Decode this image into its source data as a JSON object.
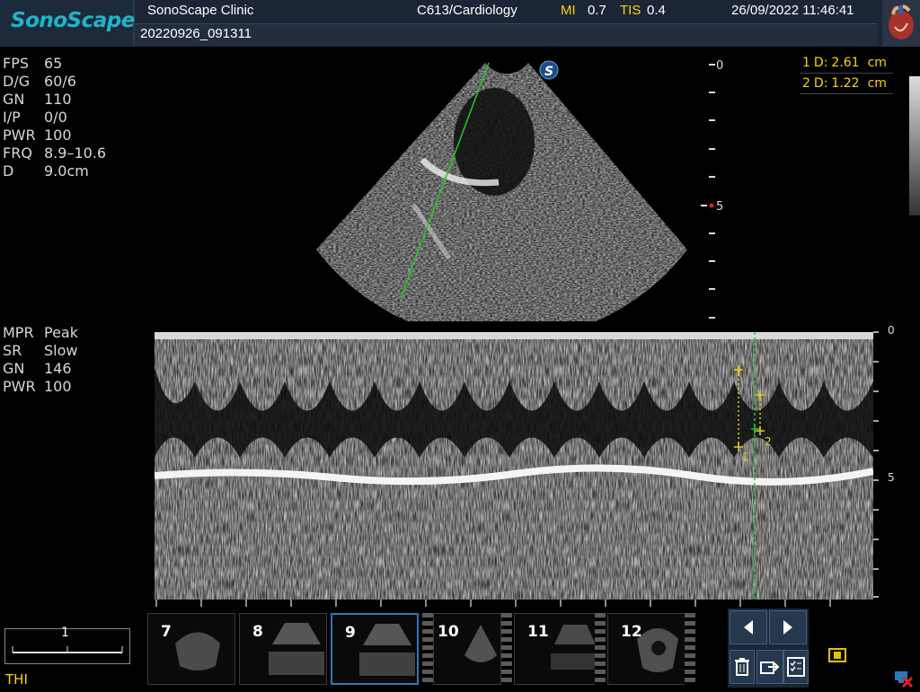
{
  "header": {
    "logo": "SonoScape",
    "clinic": "SonoScape Clinic",
    "probe_preset": "C613/Cardiology",
    "mi_label": "MI",
    "mi_value": "0.7",
    "tis_label": "TIS",
    "tis_value": "0.4",
    "datetime": "26/09/2022 11:46:41",
    "patient_id": "20220926_091311"
  },
  "bmode_params": [
    {
      "key": "FPS",
      "value": "65"
    },
    {
      "key": "D/G",
      "value": "60/6"
    },
    {
      "key": "GN",
      "value": "110"
    },
    {
      "key": "I/P",
      "value": "0/0"
    },
    {
      "key": "PWR",
      "value": "100"
    },
    {
      "key": "FRQ",
      "value": "8.9–10.6"
    },
    {
      "key": "D",
      "value": "9.0cm"
    }
  ],
  "mmode_params": [
    {
      "key": "MPR",
      "value": "Peak"
    },
    {
      "key": "SR",
      "value": "Slow"
    },
    {
      "key": "GN",
      "value": "146"
    },
    {
      "key": "PWR",
      "value": "100"
    }
  ],
  "measurements": [
    {
      "index": "1",
      "label": "D:",
      "value": "2.61",
      "unit": "cm"
    },
    {
      "index": "2",
      "label": "D:",
      "value": "1.22",
      "unit": "cm"
    }
  ],
  "depth_scale": {
    "top": "0",
    "mid": "5"
  },
  "mmode_scale": {
    "top": "0",
    "mid": "5"
  },
  "caliper_labels": {
    "one": "1",
    "two": "2"
  },
  "scale_bar_label": "1",
  "thumbnails": [
    "7",
    "8",
    "9",
    "10",
    "11",
    "12"
  ],
  "selected_thumbnail": "9",
  "mode_label": "THI",
  "icons": {
    "probe_marker": "S",
    "prev": "chevron-left-icon",
    "next": "chevron-right-icon",
    "delete": "trash-icon",
    "export": "export-icon",
    "report": "checklist-icon",
    "cine": "cine-icon",
    "network": "network-disconnected-icon",
    "heart": "heart-icon"
  },
  "colors": {
    "accent": "#ffd400",
    "logo": "#1fb5c8",
    "mline": "#22cc22",
    "selected": "#2f78b8"
  }
}
